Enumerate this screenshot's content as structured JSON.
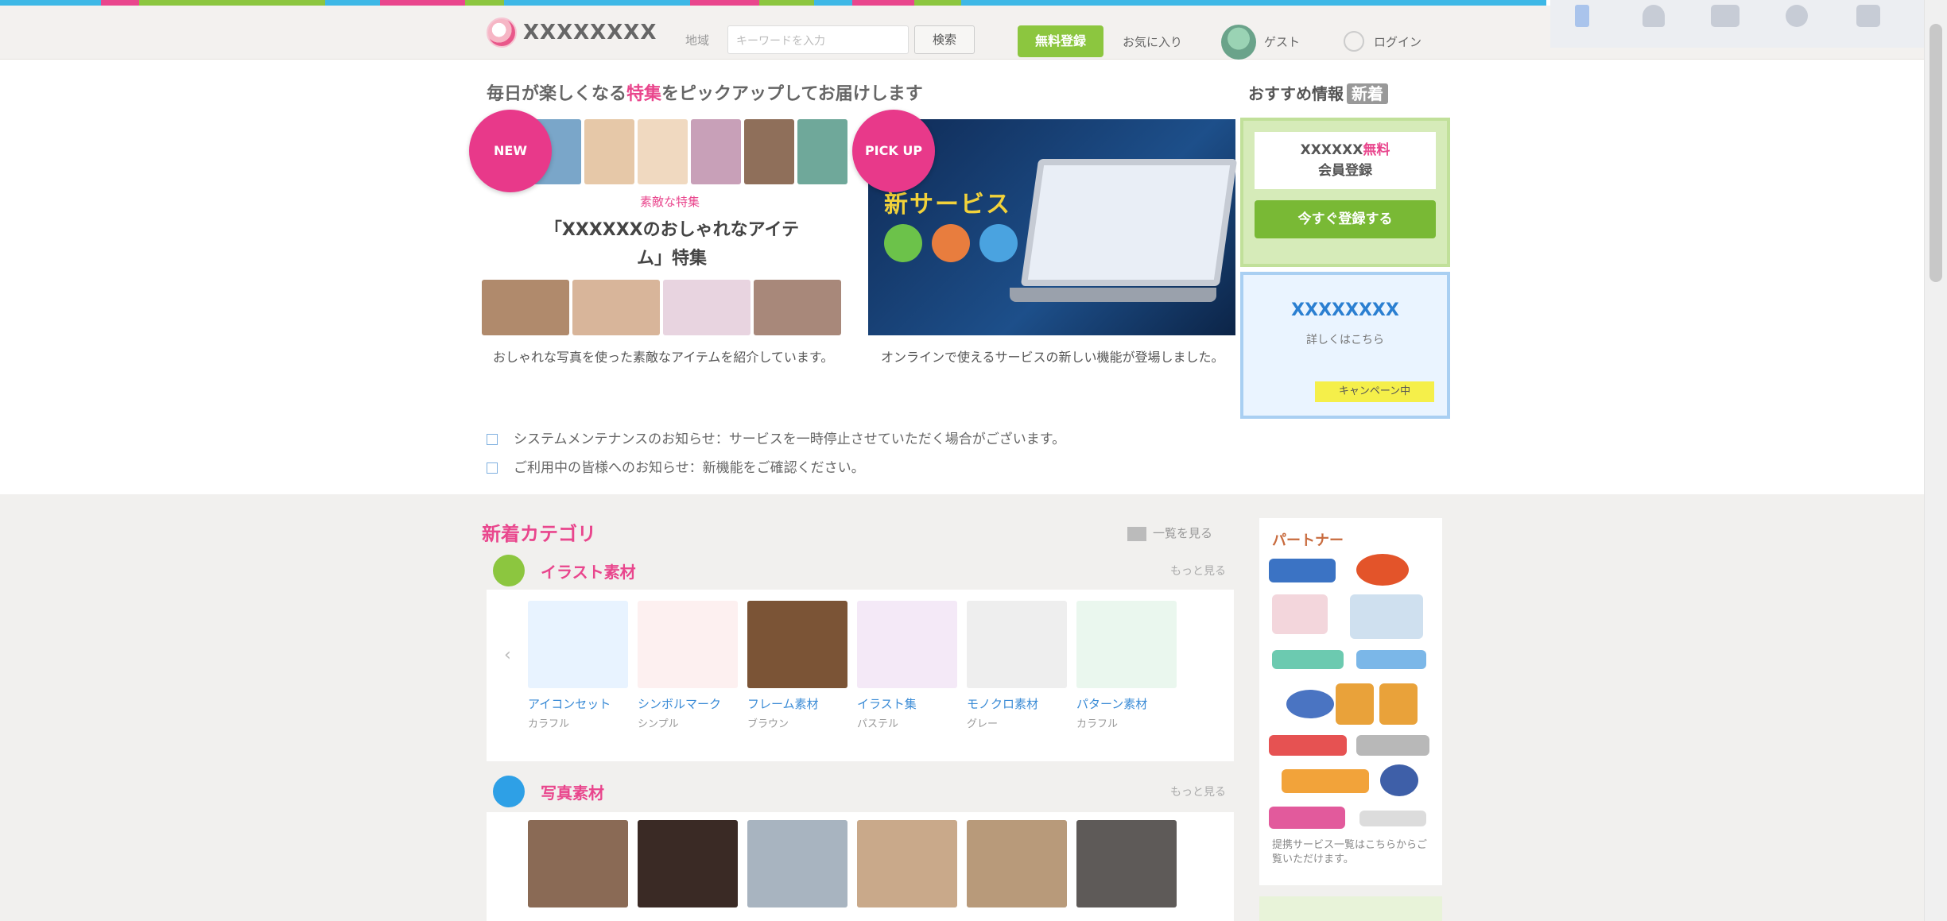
{
  "topstrip": {
    "colors": [
      "#3eb8e6",
      "#e9468d",
      "#8cc63f",
      "#3eb8e6",
      "#e9468d",
      "#8cc63f",
      "#3eb8e6",
      "#e9468d",
      "#8cc63f",
      "#3eb8e6",
      "#e9468d",
      "#8cc63f",
      "#3eb8e6"
    ]
  },
  "header": {
    "logo_text": "XXXXXXXX",
    "region_label": "地域",
    "search_placeholder": "キーワードを入力",
    "search_button": "検索",
    "register_button": "無料登録",
    "mypage_link": "お気に入り",
    "user_name": "ゲスト",
    "login_link": "ログイン",
    "icon_bar": [
      {
        "name": "bookmark",
        "label": ""
      },
      {
        "name": "user",
        "label": ""
      },
      {
        "name": "history",
        "label": ""
      },
      {
        "name": "search",
        "label": ""
      },
      {
        "name": "settings",
        "label": ""
      }
    ]
  },
  "hero": {
    "title_before": "毎日が楽しくなる",
    "title_pink": "特集",
    "title_after": "をピックアップしてお届けします",
    "side_title": "おすすめ情報",
    "side_title_badge": "新着",
    "card1": {
      "badge": "NEW",
      "subline": "素敵な特集",
      "headline": "「XXXXXXのおしゃれなアイテム」特集",
      "caption": "おしゃれな写真を使った素敵なアイテムを紹介しています。"
    },
    "card2": {
      "badge": "PICK UP",
      "laptop_text": "新サービス",
      "caption": "オンラインで使えるサービスの新しい機能が登場しました。"
    },
    "side_box1": {
      "line1_before": "XXXXXX",
      "line1_pink": "無料",
      "line2": "会員登録",
      "button": "今すぐ登録する"
    },
    "side_box2": {
      "blue_text": "XXXXXXXX",
      "gray_text": "詳しくはこちら",
      "yellow_label": "キャンペーン中"
    },
    "notices": [
      "システムメンテナンスのお知らせ：サービスを一時停止させていただく場合がございます。",
      "ご利用中の皆様へのお知らせ：新機能をご確認ください。"
    ]
  },
  "lower": {
    "section_title": "新着カテゴリ",
    "section_more": "一覧を見る",
    "categories": [
      {
        "name": "イラスト素材",
        "more": "もっと見る",
        "icon_color": "#8cc63f",
        "items": [
          {
            "title": "アイコンセット",
            "sub": "カラフル",
            "thumb": "#e8f3ff"
          },
          {
            "title": "シンボルマーク",
            "sub": "シンプル",
            "thumb": "#fdf0f0"
          },
          {
            "title": "フレーム素材",
            "sub": "ブラウン",
            "thumb": "#7b5436"
          },
          {
            "title": "イラスト集",
            "sub": "パステル",
            "thumb": "#f4e9f7"
          },
          {
            "title": "モノクロ素材",
            "sub": "グレー",
            "thumb": "#eeeeee"
          },
          {
            "title": "パターン素材",
            "sub": "カラフル",
            "thumb": "#eaf7ee"
          }
        ]
      },
      {
        "name": "写真素材",
        "more": "もっと見る",
        "icon_color": "#2ea0e6",
        "items": [
          {
            "title": "",
            "sub": "",
            "thumb": "#8a6a55"
          },
          {
            "title": "",
            "sub": "",
            "thumb": "#3a2a25"
          },
          {
            "title": "",
            "sub": "",
            "thumb": "#a8b4c0"
          },
          {
            "title": "",
            "sub": "",
            "thumb": "#c9a98a"
          },
          {
            "title": "",
            "sub": "",
            "thumb": "#b89a7a"
          },
          {
            "title": "",
            "sub": "",
            "thumb": "#5e5a58"
          }
        ]
      }
    ],
    "right_panel": {
      "title": "パートナー",
      "caption": "提携サービス一覧はこちらからご覧いただけます。"
    }
  }
}
